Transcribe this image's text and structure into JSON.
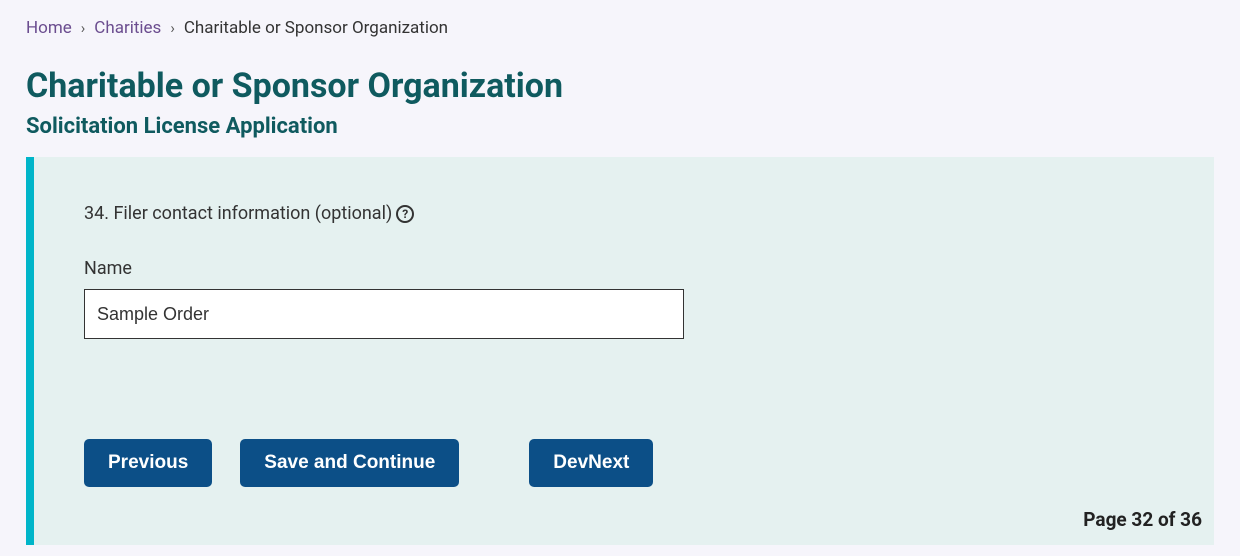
{
  "breadcrumb": {
    "home": "Home",
    "charities": "Charities",
    "current": "Charitable or Sponsor Organization"
  },
  "page": {
    "title": "Charitable or Sponsor Organization",
    "subtitle": "Solicitation License Application"
  },
  "form": {
    "question_label": "34. Filer contact information (optional)",
    "help_icon_char": "?",
    "name_label": "Name",
    "name_value": "Sample Order"
  },
  "buttons": {
    "previous": "Previous",
    "save_continue": "Save and Continue",
    "devnext": "DevNext"
  },
  "page_indicator": "Page 32 of 36"
}
